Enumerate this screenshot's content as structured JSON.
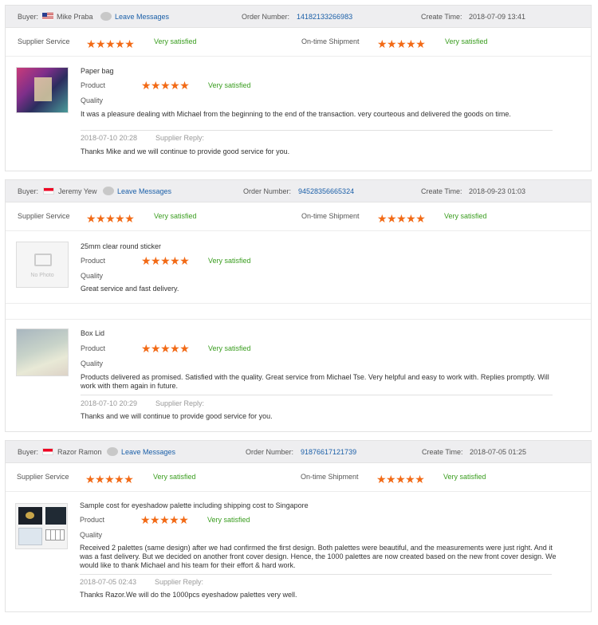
{
  "labels": {
    "buyer": "Buyer:",
    "leave_messages": "Leave Messages",
    "order_number": "Order Number:",
    "create_time": "Create Time:",
    "supplier_service": "Supplier Service",
    "ontime_shipment": "On-time Shipment",
    "very_satisfied": "Very satisfied",
    "product": "Product",
    "quality": "Quality",
    "supplier_reply": "Supplier Reply:",
    "no_photo": "No Photo"
  },
  "colors": {
    "star": "#f26a16",
    "satisfied": "#3a9d1f",
    "link": "#1a5fa8",
    "header_bg": "#eeeef0"
  },
  "stars": "★★★★★",
  "orders": [
    {
      "buyer": "Mike Praba",
      "flag": "us-flag",
      "order_number": "14182133266983",
      "create_time": "2018-07-09 13:41",
      "items": [
        {
          "product": "Paper bag",
          "review": "It was a pleasure dealing with Michael from the beginning to the end of the transaction. very courteous and delivered the goods on time.",
          "reply_date": "2018-07-10 20:28",
          "reply": "Thanks Mike and we will continue to provide good service for you."
        }
      ]
    },
    {
      "buyer": "Jeremy Yew",
      "flag": "singapore-flag",
      "order_number": "94528356665324",
      "create_time": "2018-09-23 01:03",
      "items": [
        {
          "product": "25mm clear round sticker",
          "review": "Great service and fast delivery."
        },
        {
          "product": "Box Lid",
          "review": "Products delivered as promised. Satisfied with the quality. Great service from Michael Tse. Very helpful and easy to work with. Replies promptly. Will work with them again in future.",
          "reply_date": "2018-07-10 20:29",
          "reply": "Thanks and we will continue to provide good service for you."
        }
      ]
    },
    {
      "buyer": "Razor Ramon",
      "flag": "singapore-flag",
      "order_number": "91876617121739",
      "create_time": "2018-07-05 01:25",
      "items": [
        {
          "product": "Sample cost for eyeshadow palette including shipping cost to Singapore",
          "review": "Received 2 palettes (same design) after we had confirmed the first design. Both palettes were beautiful, and the measurements were just right. And it was a fast delivery. But we decided on another front cover design. Hence, the 1000 palettes are now created based on the new front cover design. We would like to thank Michael and his team for their effort & hard work.",
          "reply_date": "2018-07-05 02:43",
          "reply": "Thanks Razor.We will do the 1000pcs eyeshadow palettes very well."
        }
      ]
    }
  ]
}
